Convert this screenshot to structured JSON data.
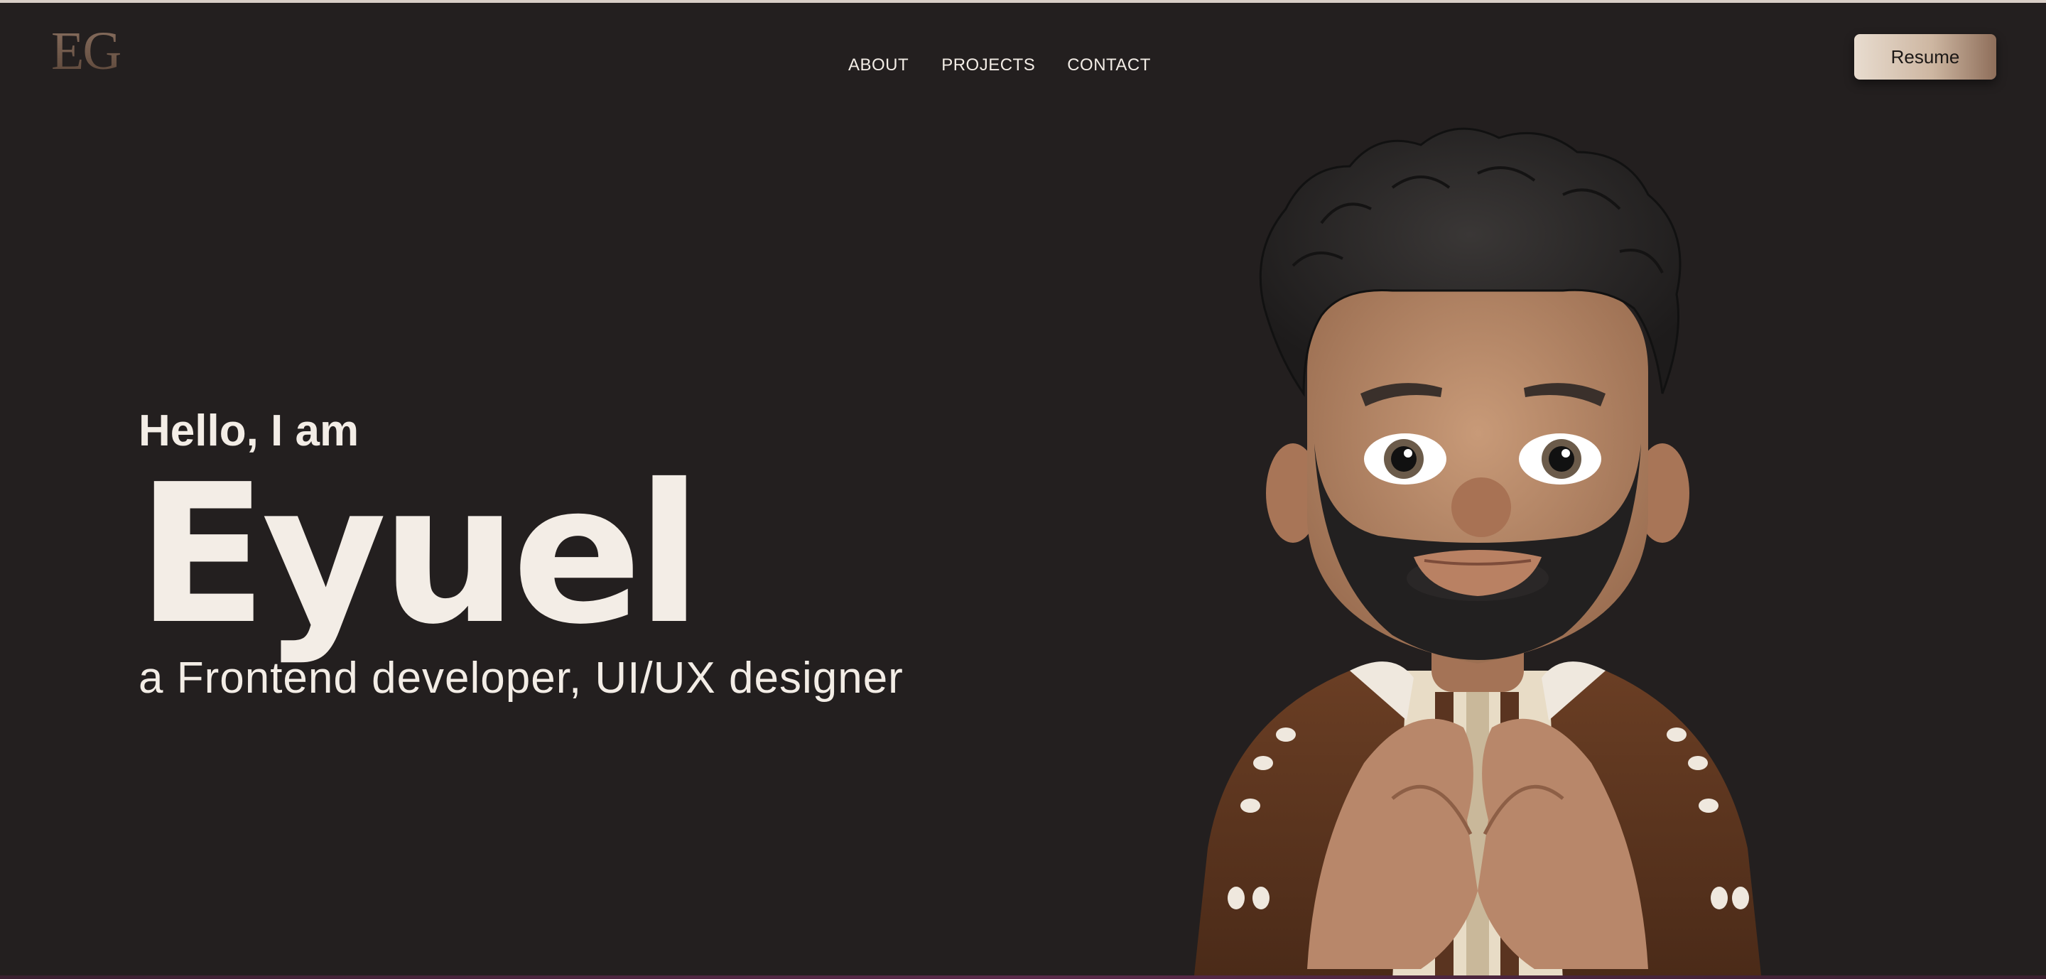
{
  "header": {
    "logo": "EG",
    "nav": [
      "ABOUT",
      "PROJECTS",
      "CONTACT"
    ],
    "resume_label": "Resume"
  },
  "hero": {
    "greeting": "Hello, I am",
    "name": "Eyuel",
    "role": "a Frontend developer, UI/UX designer"
  },
  "colors": {
    "background": "#231f1f",
    "text": "#f3ede6",
    "accent": "#cdb6a1"
  },
  "icons": {
    "avatar": "memoji-heart-hands-avatar"
  }
}
